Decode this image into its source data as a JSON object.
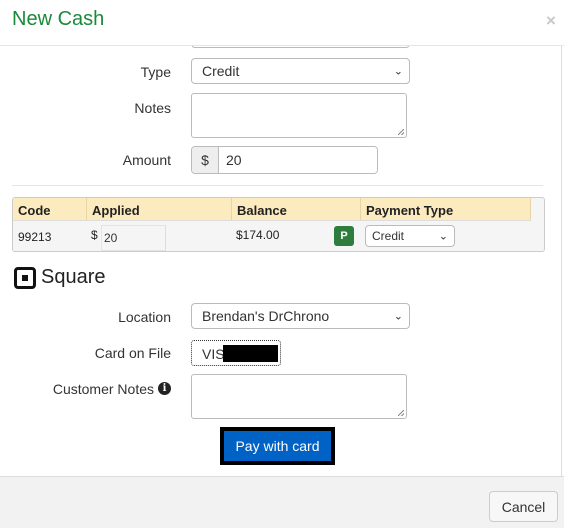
{
  "header": {
    "title": "New Cash",
    "close_icon": "close-icon"
  },
  "form": {
    "type_label": "Type",
    "type_value": "Credit",
    "notes_label": "Notes",
    "notes_value": "",
    "amount_label": "Amount",
    "amount_prefix": "$",
    "amount_value": "20"
  },
  "table": {
    "columns": [
      "Code",
      "Applied",
      "Balance",
      "Payment Type"
    ],
    "rows": [
      {
        "code": "99213",
        "applied_prefix": "$",
        "applied": "20",
        "balance": "$174.00",
        "badge": "P",
        "payment_type": "Credit"
      }
    ]
  },
  "square": {
    "logo_text": "Square",
    "location_label": "Location",
    "location_value": "Brendan's DrChrono",
    "card_label": "Card on File",
    "card_value": "VISA",
    "customer_notes_label": "Customer Notes",
    "customer_notes_value": "",
    "pay_button": "Pay with card"
  },
  "footer": {
    "cancel": "Cancel"
  },
  "colors": {
    "title": "#1a8a3a",
    "pay_button": "#0062c4",
    "badge": "#2e7d3e",
    "table_header": "#fdebc0"
  }
}
